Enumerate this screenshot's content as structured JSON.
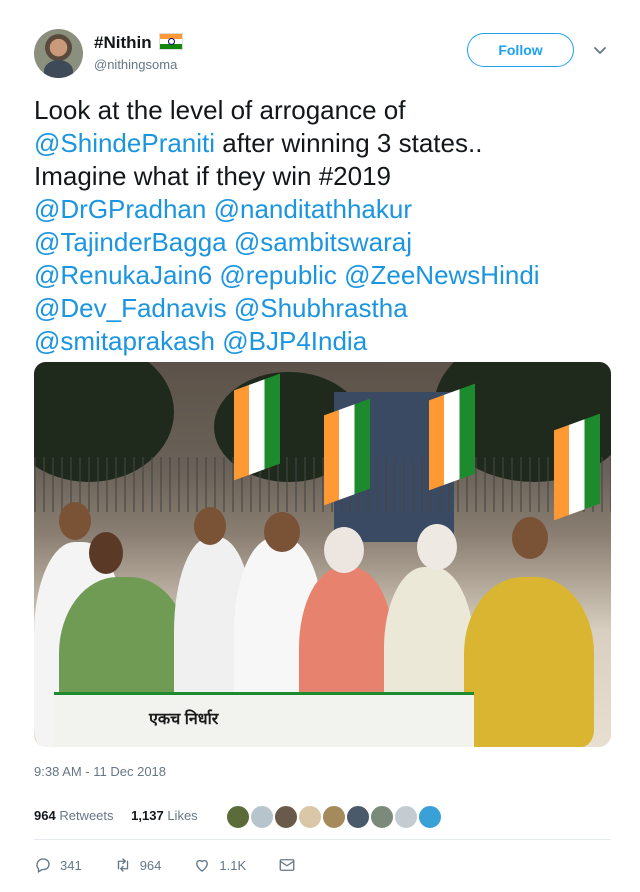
{
  "author": {
    "name": "#Nithin",
    "handle": "@nithingsoma",
    "avatar_icon": "profile-photo",
    "flag_icon": "india-flag-emoji"
  },
  "follow_button": {
    "label": "Follow",
    "color": "#1da1f2"
  },
  "tweet": {
    "lines": [
      [
        {
          "text": "Look at the level of arrogance of",
          "mention": false
        }
      ],
      [
        {
          "text": "@ShindePraniti",
          "mention": true
        },
        {
          "text": " after winning 3 states..",
          "mention": false
        }
      ],
      [
        {
          "text": "Imagine what if they win #2019",
          "mention": false
        }
      ],
      [
        {
          "text": "@DrGPradhan",
          "mention": true
        },
        {
          "text": " ",
          "mention": false
        },
        {
          "text": "@nanditathhakur",
          "mention": true
        }
      ],
      [
        {
          "text": "@TajinderBagga",
          "mention": true
        },
        {
          "text": " ",
          "mention": false
        },
        {
          "text": "@sambitswaraj",
          "mention": true
        }
      ],
      [
        {
          "text": "@RenukaJain6",
          "mention": true
        },
        {
          "text": " ",
          "mention": false
        },
        {
          "text": "@republic",
          "mention": true
        },
        {
          "text": " ",
          "mention": false
        },
        {
          "text": "@ZeeNewsHindi",
          "mention": true
        }
      ],
      [
        {
          "text": "@Dev_Fadnavis",
          "mention": true
        },
        {
          "text": " ",
          "mention": false
        },
        {
          "text": "@Shubhrastha",
          "mention": true
        }
      ],
      [
        {
          "text": "@smitaprakash",
          "mention": true
        },
        {
          "text": " ",
          "mention": false
        },
        {
          "text": "@BJP4India",
          "mention": true
        }
      ]
    ],
    "mention_color": "#1b95e0"
  },
  "photo": {
    "banner_text": "एकच निर्धार"
  },
  "timestamp": "9:38 AM - 11 Dec 2018",
  "stats": {
    "retweets_count": "964",
    "retweets_label": "Retweets",
    "likes_count": "1,137",
    "likes_label": "Likes"
  },
  "likers": [
    "#5b6b3a",
    "#b8c4cc",
    "#6a5a4a",
    "#d9c7a8",
    "#a58a5c",
    "#4a5a6a",
    "#7b8a7a",
    "#c4ccd2",
    "#3aa0d8"
  ],
  "actions": {
    "reply_count": "341",
    "retweet_count": "964",
    "like_count": "1.1K"
  },
  "icons": {
    "chevron": "chevron-down-icon",
    "reply": "reply-icon",
    "retweet": "retweet-icon",
    "like": "heart-icon",
    "message": "envelope-icon"
  }
}
